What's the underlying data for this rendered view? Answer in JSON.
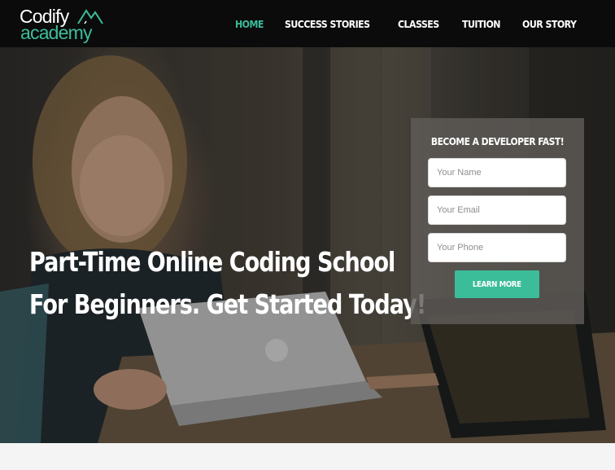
{
  "logo": {
    "line1": "Codify",
    "line2": "academy",
    "mark": "codify-mountain-logo",
    "accent": "#3cbd9a"
  },
  "nav": {
    "items": [
      {
        "label": "HOME",
        "active": true
      },
      {
        "label": "SUCCESS STORIES",
        "active": false
      },
      {
        "label": "CLASSES",
        "active": false
      },
      {
        "label": "TUITION",
        "active": false
      },
      {
        "label": "OUR STORY",
        "active": false
      }
    ]
  },
  "hero": {
    "headline_line1": "Part-Time Online Coding School",
    "headline_line2": "For Beginners. Get Started Today!",
    "image": "woman-smiling-at-laptop-photo"
  },
  "form": {
    "title": "BECOME A DEVELOPER FAST!",
    "name_placeholder": "Your Name",
    "email_placeholder": "Your Email",
    "phone_placeholder": "Your Phone",
    "button_label": "LEARN MORE"
  },
  "colors": {
    "topbar": "#0b0b0b",
    "accent": "#3cbd9a",
    "footer": "#f4f4f4"
  }
}
